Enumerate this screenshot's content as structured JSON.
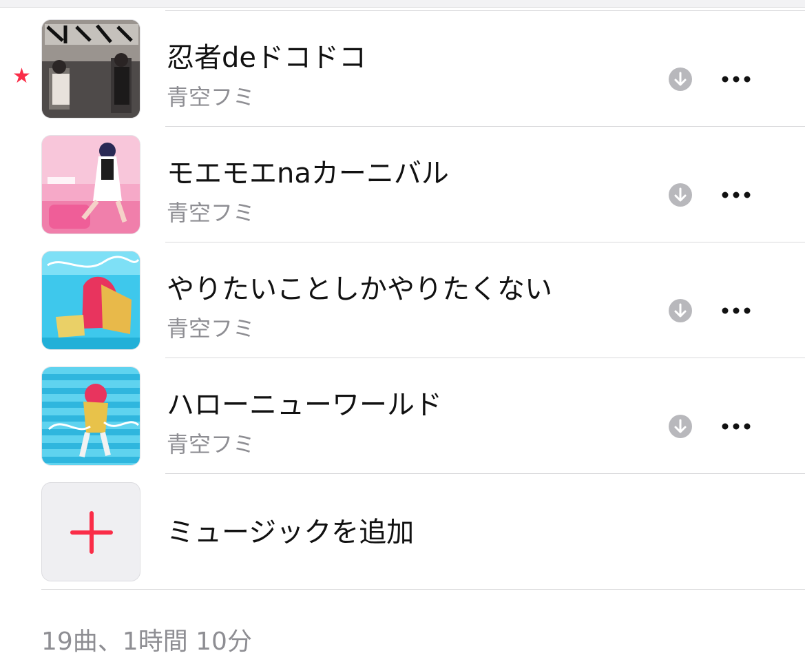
{
  "colors": {
    "accent": "#fa2d48",
    "secondary_text": "#8e8e93",
    "icon_gray": "#b8b8bc",
    "divider": "#d8d8da"
  },
  "favorite_icon": "star-icon",
  "tracks": [
    {
      "title": "忍者deドコドコ",
      "artist": "青空フミ",
      "favorite": true,
      "icons": [
        "download-icon",
        "more-icon"
      ]
    },
    {
      "title": "モエモエnaカーニバル",
      "artist": "青空フミ",
      "favorite": false,
      "icons": [
        "download-icon",
        "more-icon"
      ]
    },
    {
      "title": "やりたいことしかやりたくない",
      "artist": "青空フミ",
      "favorite": false,
      "icons": [
        "download-icon",
        "more-icon"
      ]
    },
    {
      "title": "ハローニューワールド",
      "artist": "青空フミ",
      "favorite": false,
      "icons": [
        "download-icon",
        "more-icon"
      ]
    }
  ],
  "add_music": {
    "label": "ミュージックを追加",
    "icon": "plus-icon"
  },
  "summary": "19曲、1時間 10分"
}
